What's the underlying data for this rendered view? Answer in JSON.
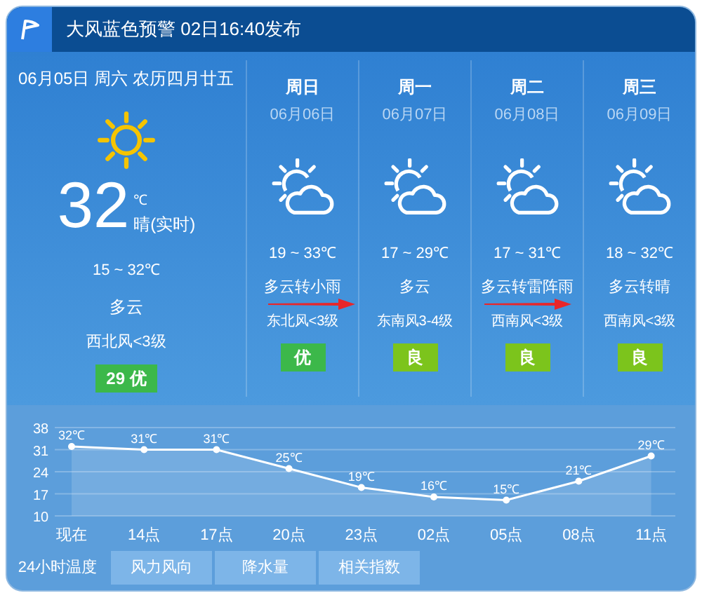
{
  "alert": {
    "text": "大风蓝色预警 02日16:40发布"
  },
  "today": {
    "date": "06月05日 周六 农历四月廿五",
    "temp": "32",
    "unit": "℃",
    "condition": "晴(实时)",
    "range": "15 ~ 32℃",
    "weather": "多云",
    "wind": "西北风<3级",
    "aqi": "29 优",
    "color": "#3cb84a"
  },
  "forecast": [
    {
      "day": "周日",
      "date": "06月06日",
      "range": "19 ~ 33℃",
      "weather": "多云转小雨",
      "wind": "东北风<3级",
      "aqi": "优",
      "color": "#3cb84a"
    },
    {
      "day": "周一",
      "date": "06月07日",
      "range": "17 ~ 29℃",
      "weather": "多云",
      "wind": "东南风3-4级",
      "aqi": "良",
      "color": "#7cc41c"
    },
    {
      "day": "周二",
      "date": "06月08日",
      "range": "17 ~ 31℃",
      "weather": "多云转雷阵雨",
      "wind": "西南风<3级",
      "aqi": "良",
      "color": "#7cc41c"
    },
    {
      "day": "周三",
      "date": "06月09日",
      "range": "18 ~ 32℃",
      "weather": "多云转晴",
      "wind": "西南风<3级",
      "aqi": "良",
      "color": "#7cc41c"
    }
  ],
  "chart_data": {
    "type": "area",
    "categories": [
      "现在",
      "14点",
      "17点",
      "20点",
      "23点",
      "02点",
      "05点",
      "08点",
      "11点"
    ],
    "series": [
      {
        "color": "#ffffff",
        "values": [
          32,
          31,
          31,
          25,
          19,
          16,
          15,
          21,
          29
        ]
      }
    ],
    "ylim": [
      10,
      38
    ],
    "yticks": [
      38,
      31,
      24,
      17,
      10
    ],
    "grid": true,
    "value_labels": [
      "32℃",
      "31℃",
      "31℃",
      "25℃",
      "19℃",
      "16℃",
      "15℃",
      "21℃",
      "29℃"
    ]
  },
  "tabs": [
    {
      "label": "24小时温度",
      "selected": true
    },
    {
      "label": "风力风向",
      "selected": false
    },
    {
      "label": "降水量",
      "selected": false
    },
    {
      "label": "相关指数",
      "selected": false
    }
  ]
}
